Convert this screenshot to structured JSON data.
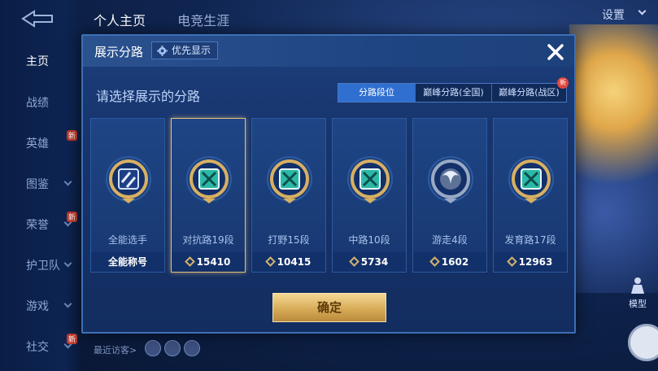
{
  "topbar": {
    "tabs": [
      "个人主页",
      "电竞生涯"
    ],
    "settings_label": "设置"
  },
  "sidebar": {
    "items": [
      {
        "label": "主页",
        "active": true,
        "chevron": false,
        "new": false
      },
      {
        "label": "战绩",
        "active": false,
        "chevron": false,
        "new": false
      },
      {
        "label": "英雄",
        "active": false,
        "chevron": false,
        "new": true
      },
      {
        "label": "图鉴",
        "active": false,
        "chevron": true,
        "new": false
      },
      {
        "label": "荣誉",
        "active": false,
        "chevron": true,
        "new": true
      },
      {
        "label": "护卫队",
        "active": false,
        "chevron": true,
        "new": false
      },
      {
        "label": "游戏",
        "active": false,
        "chevron": true,
        "new": false
      },
      {
        "label": "社交",
        "active": false,
        "chevron": true,
        "new": true
      }
    ],
    "new_tag": "新"
  },
  "right_panel": {
    "model_label": "模型"
  },
  "footer": {
    "recent_visitors_label": "最近访客>"
  },
  "dialog": {
    "title": "展示分路",
    "priority_label": "优先显示",
    "prompt": "请选择展示的分路",
    "tabs": [
      {
        "label": "分路段位",
        "active": true
      },
      {
        "label": "巅峰分路(全国)",
        "active": false
      },
      {
        "label": "巅峰分路(战区)",
        "active": false
      }
    ],
    "new_tag": "新",
    "lanes": [
      {
        "name": "全能选手",
        "score": "全能称号",
        "selected": false,
        "icon": "all-round-badge-icon"
      },
      {
        "name": "对抗路19段",
        "score": "15410",
        "selected": true,
        "icon": "clash-lane-badge-icon"
      },
      {
        "name": "打野15段",
        "score": "10415",
        "selected": false,
        "icon": "jungle-badge-icon"
      },
      {
        "name": "中路10段",
        "score": "5734",
        "selected": false,
        "icon": "mid-lane-badge-icon"
      },
      {
        "name": "游走4段",
        "score": "1602",
        "selected": false,
        "icon": "roam-badge-icon"
      },
      {
        "name": "发育路17段",
        "score": "12963",
        "selected": false,
        "icon": "farm-lane-badge-icon"
      }
    ],
    "confirm_label": "确定"
  },
  "colors": {
    "accent": "#2f6fd0",
    "gold": "#d7ac58",
    "teal": "#26b8a6"
  }
}
